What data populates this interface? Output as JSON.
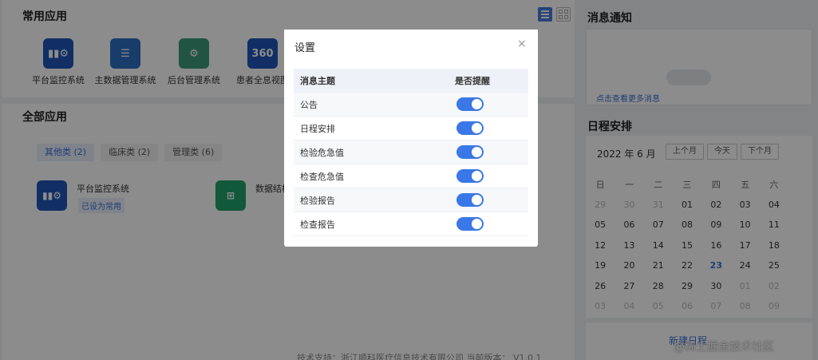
{
  "main": {
    "common_title": "常用应用",
    "all_title": "全部应用",
    "common_apps": [
      {
        "label": "平台监控系统",
        "icon": "monitor-icon",
        "glyph": "▮▮⚙",
        "color": "#1f56b8"
      },
      {
        "label": "主数据管理系统",
        "icon": "server-icon",
        "glyph": "☰",
        "color": "#2c6fc4"
      },
      {
        "label": "后台管理系统",
        "icon": "gear-icon",
        "glyph": "⚙",
        "color": "#3e9a7a"
      },
      {
        "label": "患者全息视图",
        "icon": "360-icon",
        "glyph": "360",
        "color": "#1f56b8"
      }
    ],
    "category_tabs": [
      {
        "label": "其他类 (2)",
        "active": true
      },
      {
        "label": "临床类 (2)",
        "active": false
      },
      {
        "label": "管理类 (6)",
        "active": false
      }
    ],
    "all_apps": [
      {
        "name": "平台监控系统",
        "badge": "已设为常用",
        "icon": "monitor-icon",
        "glyph": "▮▮⚙",
        "color": "#1f56b8"
      },
      {
        "name": "数据结构",
        "badge": "",
        "icon": "structure-icon",
        "glyph": "⊞",
        "color": "#1fa36a"
      }
    ],
    "footer": "技术支持：浙江顺科医疗信息技术有限公司 当前版本： V1.0.1"
  },
  "right": {
    "msg_title": "消息通知",
    "msg_more": "点击查看更多消息",
    "sched_title": "日程安排",
    "calendar": {
      "month_label": "2022 年 6 月",
      "prev": "上个月",
      "today": "今天",
      "next": "下个月",
      "weekdays": [
        "日",
        "一",
        "二",
        "三",
        "四",
        "五",
        "六"
      ],
      "weeks": [
        [
          "29",
          "30",
          "31",
          "01",
          "02",
          "03",
          "04"
        ],
        [
          "05",
          "06",
          "07",
          "08",
          "09",
          "10",
          "11"
        ],
        [
          "12",
          "13",
          "14",
          "15",
          "16",
          "17",
          "18"
        ],
        [
          "19",
          "20",
          "21",
          "22",
          "23",
          "24",
          "25"
        ],
        [
          "26",
          "27",
          "28",
          "29",
          "30",
          "01",
          "02"
        ],
        [
          "03",
          "04",
          "05",
          "06",
          "07",
          "08",
          "09"
        ]
      ],
      "today_date": "23"
    },
    "new_schedule": "新建日程"
  },
  "watermark": "@稀土掘金技术社区",
  "modal": {
    "title": "设置",
    "close": "×",
    "col_topic": "消息主题",
    "col_remind": "是否提醒",
    "rows": [
      {
        "topic": "公告",
        "enabled": true
      },
      {
        "topic": "日程安排",
        "enabled": true
      },
      {
        "topic": "检验危急值",
        "enabled": true
      },
      {
        "topic": "检查危急值",
        "enabled": true
      },
      {
        "topic": "检验报告",
        "enabled": true
      },
      {
        "topic": "检查报告",
        "enabled": true
      }
    ]
  },
  "colors": {
    "accent": "#3b78e7",
    "link": "#3b6fd4"
  }
}
